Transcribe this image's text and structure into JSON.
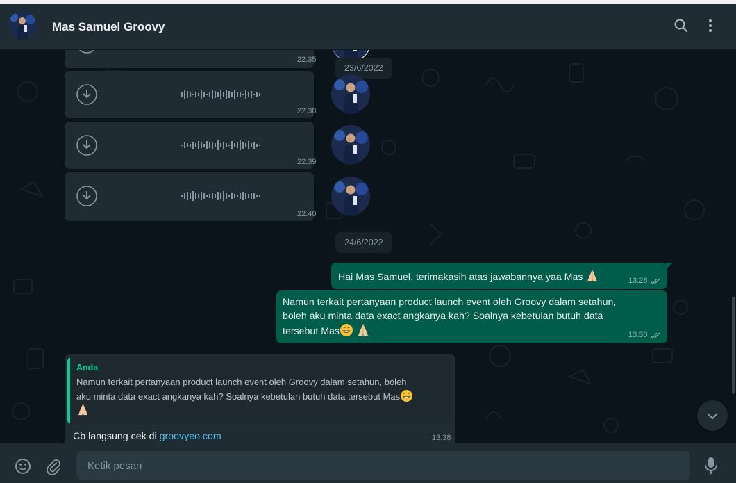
{
  "header": {
    "contact_name": "Mas Samuel Groovy",
    "icons": [
      "avatar",
      "search-icon",
      "menu-icon"
    ]
  },
  "chat": {
    "date_dividers": [
      "23/6/2022",
      "24/6/2022"
    ],
    "voice_notes": [
      {
        "time": "22.35"
      },
      {
        "time": "22.38"
      },
      {
        "time": "22.39"
      },
      {
        "time": "22.40"
      }
    ],
    "outgoing": [
      {
        "text": "Hai Mas Samuel, terimakasih atas jawabannya yaa Mas",
        "emoji": [
          "folded-hands"
        ],
        "time": "13.28",
        "status": "read"
      },
      {
        "line1": "Namun terkait pertanyaan product launch event oleh Groovy dalam setahun,",
        "line2": "boleh aku minta data exact angkanya kah? Soalnya kebetulan butuh data",
        "line3": "tersebut Mas",
        "emoji": [
          "grinning-face",
          "folded-hands"
        ],
        "time": "13.30",
        "status": "read"
      }
    ],
    "incoming_reply": {
      "quote_author": "Anda",
      "quote_line1": "Namun terkait pertanyaan product launch event oleh Groovy dalam setahun, boleh",
      "quote_line2": "aku minta data exact angkanya kah? Soalnya kebetulan butuh data tersebut Mas",
      "text_prefix": "Cb langsung cek di ",
      "link": "groovyeo.com",
      "time": "13.38"
    }
  },
  "composer": {
    "placeholder": "Ketik pesan",
    "icons": [
      "emoji-icon",
      "attach-icon",
      "mic-icon"
    ]
  },
  "colors": {
    "header_bg": "#202c33",
    "chat_bg": "#0b141a",
    "outgoing_bubble": "#005c4b",
    "incoming_bubble": "#202c33",
    "accent": "#06cf9c",
    "link": "#53bdeb"
  }
}
